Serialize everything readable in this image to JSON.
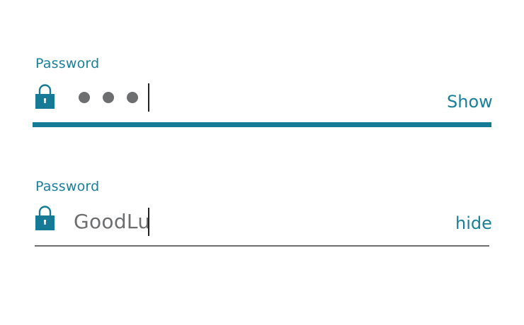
{
  "colors": {
    "accent": "#147a96",
    "text_muted": "#6d6e70"
  },
  "fields": [
    {
      "label": "Password",
      "masked_length": 3,
      "toggle_label": "Show",
      "focused": true,
      "icon": "lock-icon"
    },
    {
      "label": "Password",
      "value": "GoodLu",
      "toggle_label": "hide",
      "focused": false,
      "icon": "lock-icon"
    }
  ]
}
